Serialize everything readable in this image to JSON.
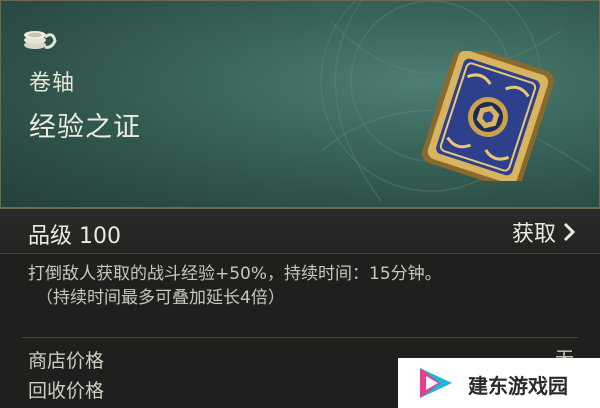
{
  "item": {
    "category": "卷轴",
    "name": "经验之证",
    "category_icon": "coin-stack-icon",
    "art": "scroll-card-art"
  },
  "grade": {
    "text": "品级 100",
    "obtain_label": "获取",
    "obtain_icon": "chevron-right-icon"
  },
  "description": {
    "line1": "打倒敌人获取的战斗经验+50%，持续时间：15分钟。",
    "line2": "（持续时间最多可叠加延长4倍）"
  },
  "prices": {
    "shop_label": "商店价格",
    "shop_value": "无",
    "recycle_label": "回收价格"
  },
  "watermark": {
    "text": "建东游戏园"
  },
  "colors": {
    "hero_bg": "#3b665c",
    "gold_border": "#6f6a4c",
    "card_blue": "#2e3f8c",
    "card_gold": "#c9a24a"
  }
}
